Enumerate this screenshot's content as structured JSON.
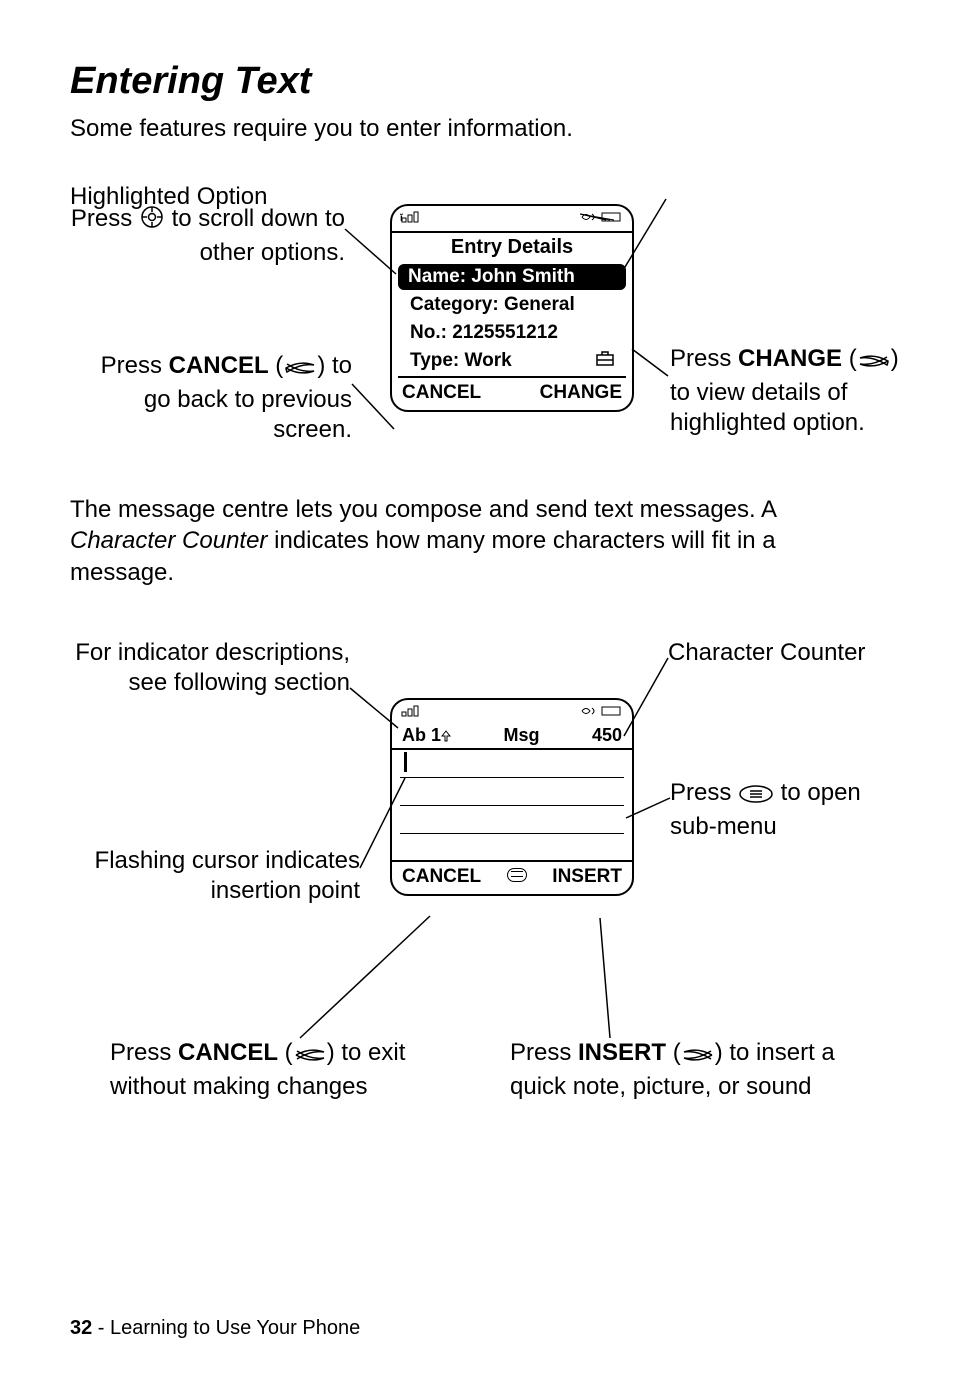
{
  "title": "Entering Text",
  "intro": "Some features require you to enter information.",
  "phone1": {
    "title": "Entry Details",
    "name": "Name: John Smith",
    "category": "Category: General",
    "number": "No.: 2125551212",
    "type": "Type: Work",
    "softleft": "CANCEL",
    "softright": "CHANGE"
  },
  "callouts1": {
    "scroll_pre": "Press ",
    "scroll_post": " to scroll down to other options.",
    "cancel_pre": "Press ",
    "cancel_key": "CANCEL",
    "cancel_mid": " (",
    "cancel_post": ") to go back to previous screen.",
    "highlighted": "Highlighted Option",
    "change_pre": "Press ",
    "change_key": "CHANGE",
    "change_mid": " (",
    "change_post": ") to view details of highlighted option."
  },
  "para2_a": "The message centre lets you compose and send text messages. A ",
  "para2_b": "Character Counter",
  "para2_c": " indicates how many more characters will fit in a message.",
  "phone2": {
    "mode": "Ab 1",
    "title": "Msg",
    "counter": "450",
    "softleft": "CANCEL",
    "softright": "INSERT"
  },
  "callouts2": {
    "indicator": "For indicator descriptions, see following section",
    "cursor": "Flashing cursor indicates insertion point",
    "counter": "Character Counter",
    "submenu_pre": "Press ",
    "submenu_post": " to open sub-menu",
    "cancel_pre": "Press ",
    "cancel_key": "CANCEL",
    "cancel_mid": " (",
    "cancel_post": ") to exit without making changes",
    "insert_pre": "Press ",
    "insert_key": "INSERT",
    "insert_mid": " (",
    "insert_post": ") to insert a quick note, picture, or sound"
  },
  "footer": {
    "page": "32",
    "sep": " - ",
    "section": "Learning to Use Your Phone"
  }
}
